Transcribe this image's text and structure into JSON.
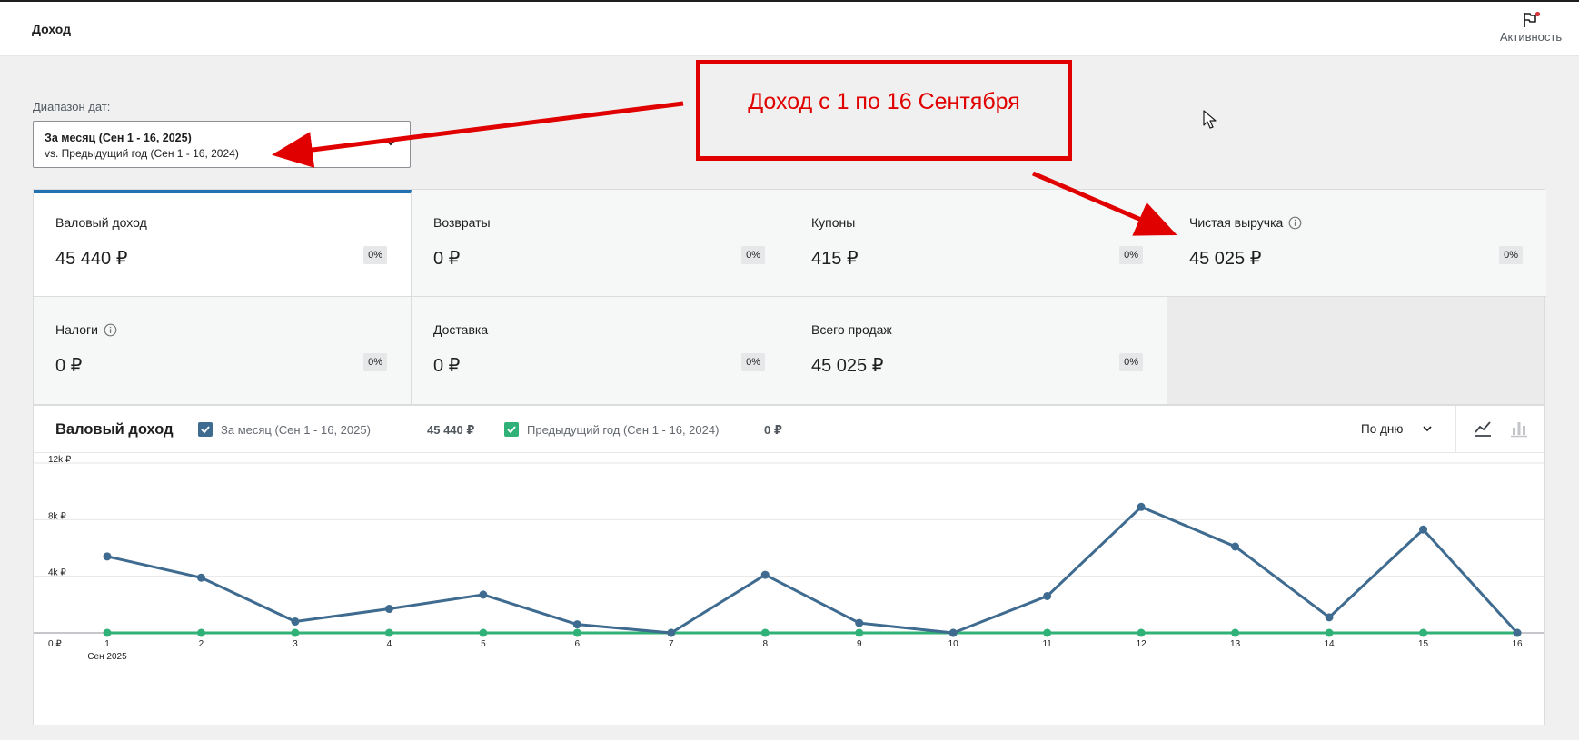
{
  "header": {
    "title": "Доход",
    "activity_label": "Активность"
  },
  "date_range": {
    "label": "Диапазон дат:",
    "primary": "За месяц (Сен 1 - 16, 2025)",
    "secondary": "vs. Предыдущий год (Сен 1 - 16, 2024)"
  },
  "callout": {
    "text": "Доход с 1 по 16 Сентября"
  },
  "cards": [
    {
      "label": "Валовый доход",
      "value": "45 440 ₽",
      "delta": "0%",
      "info": false,
      "active": true
    },
    {
      "label": "Возвраты",
      "value": "0 ₽",
      "delta": "0%",
      "info": false
    },
    {
      "label": "Купоны",
      "value": "415 ₽",
      "delta": "0%",
      "info": false
    },
    {
      "label": "Чистая выручка",
      "value": "45 025 ₽",
      "delta": "0%",
      "info": true
    },
    {
      "label": "Налоги",
      "value": "0 ₽",
      "delta": "0%",
      "info": true
    },
    {
      "label": "Доставка",
      "value": "0 ₽",
      "delta": "0%",
      "info": false
    },
    {
      "label": "Всего продаж",
      "value": "45 025 ₽",
      "delta": "0%",
      "info": false
    }
  ],
  "chart_panel": {
    "title": "Валовый доход",
    "legend": [
      {
        "label": "За месяц (Сен 1 - 16, 2025)",
        "total": "45 440 ₽",
        "color": "#3e6b8f"
      },
      {
        "label": "Предыдущий год (Сен 1 - 16, 2024)",
        "total": "0 ₽",
        "color": "#2fb177"
      }
    ],
    "interval": "По дню"
  },
  "chart_data": {
    "type": "line",
    "title": "",
    "x": [
      1,
      2,
      3,
      4,
      5,
      6,
      7,
      8,
      9,
      10,
      11,
      12,
      13,
      14,
      15,
      16
    ],
    "x_tick_labels": [
      "1",
      "2",
      "3",
      "4",
      "5",
      "6",
      "7",
      "8",
      "9",
      "10",
      "11",
      "12",
      "13",
      "14",
      "15",
      "16"
    ],
    "x_sublabel": "Сен 2025",
    "ylim": [
      0,
      12000
    ],
    "y_ticks": [
      0,
      4000,
      8000,
      12000
    ],
    "y_tick_labels": [
      "0 ₽",
      "4k ₽",
      "8k ₽",
      "12k ₽"
    ],
    "grid": true,
    "series": [
      {
        "name": "За месяц (Сен 1 - 16, 2025)",
        "color": "#3e6b8f",
        "values": [
          5400,
          3900,
          800,
          1700,
          2700,
          600,
          0,
          4100,
          700,
          0,
          2600,
          8900,
          6100,
          1100,
          7300,
          0
        ]
      },
      {
        "name": "Предыдущий год (Сен 1 - 16, 2024)",
        "color": "#2fb177",
        "values": [
          0,
          0,
          0,
          0,
          0,
          0,
          0,
          0,
          0,
          0,
          0,
          0,
          0,
          0,
          0,
          0
        ]
      }
    ]
  },
  "colors": {
    "accent": "#2271b1",
    "annotation": "#e10000",
    "series_current": "#3e6b8f",
    "series_previous": "#2fb177"
  },
  "icons": {
    "activity": "flag-icon",
    "chevron": "chevron-down-icon",
    "info": "info-icon",
    "line_chart": "line-chart-icon",
    "bar_chart": "bar-chart-icon"
  }
}
